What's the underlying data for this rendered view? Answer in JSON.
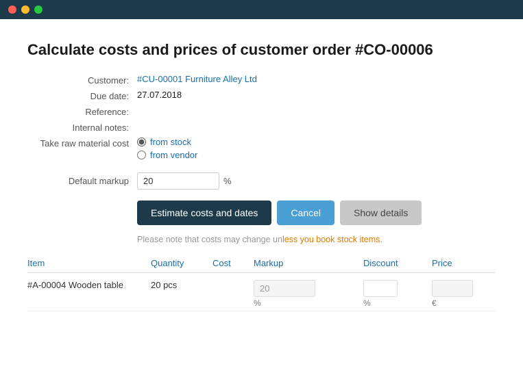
{
  "titlebar": {
    "btn_red": "red",
    "btn_yellow": "yellow",
    "btn_green": "green"
  },
  "page": {
    "title": "Calculate costs and prices of customer order #CO-00006",
    "fields": {
      "customer_label": "Customer:",
      "customer_value": "#CU-00001 Furniture Alley Ltd",
      "due_date_label": "Due date:",
      "due_date_value": "27.07.2018",
      "reference_label": "Reference:",
      "reference_value": "",
      "internal_notes_label": "Internal notes:",
      "internal_notes_value": "",
      "raw_material_label": "Take raw material cost",
      "radio_stock": "from stock",
      "radio_vendor": "from vendor",
      "markup_label": "Default markup",
      "markup_value": "20",
      "markup_unit": "%"
    },
    "buttons": {
      "estimate": "Estimate costs and dates",
      "cancel": "Cancel",
      "show_details": "Show details"
    },
    "notice": "Please note that costs may change unless you book stock items.",
    "table": {
      "headers": {
        "item": "Item",
        "quantity": "Quantity",
        "cost": "Cost",
        "markup": "Markup",
        "discount": "Discount",
        "price": "Price"
      },
      "rows": [
        {
          "item": "#A-00004 Wooden table",
          "quantity": "20 pcs",
          "cost": "",
          "markup_value": "20",
          "markup_unit": "%",
          "discount_value": "",
          "discount_unit": "%",
          "price_value": "",
          "price_unit": "€"
        }
      ]
    }
  }
}
